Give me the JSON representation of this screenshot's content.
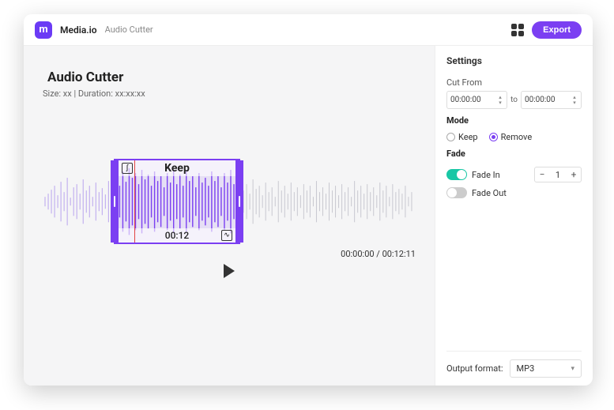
{
  "header": {
    "brand": "Media.io",
    "crumb": "Audio Cutter",
    "export_label": "Export",
    "logo_letter": "m"
  },
  "main": {
    "title": "Audio Cutter",
    "meta": "Size: xx | Duration: xx:xx:xx",
    "selection": {
      "label": "Keep",
      "time": "00:12"
    },
    "timecode": "00:00:00 / 00:12:11"
  },
  "settings": {
    "heading": "Settings",
    "cut_from_label": "Cut From",
    "from_time": "00:00:00",
    "to_label": "to",
    "to_time": "00:00:00",
    "mode_label": "Mode",
    "mode_keep": "Keep",
    "mode_remove": "Remove",
    "mode_selected": "remove",
    "fade_label": "Fade",
    "fade_in_label": "Fade In",
    "fade_in_on": true,
    "fade_in_value": "1",
    "fade_out_label": "Fade Out",
    "fade_out_on": false,
    "output_label": "Output format:",
    "output_value": "MP3"
  },
  "colors": {
    "accent": "#7b3ff2",
    "toggle_on": "#19c7a5"
  }
}
